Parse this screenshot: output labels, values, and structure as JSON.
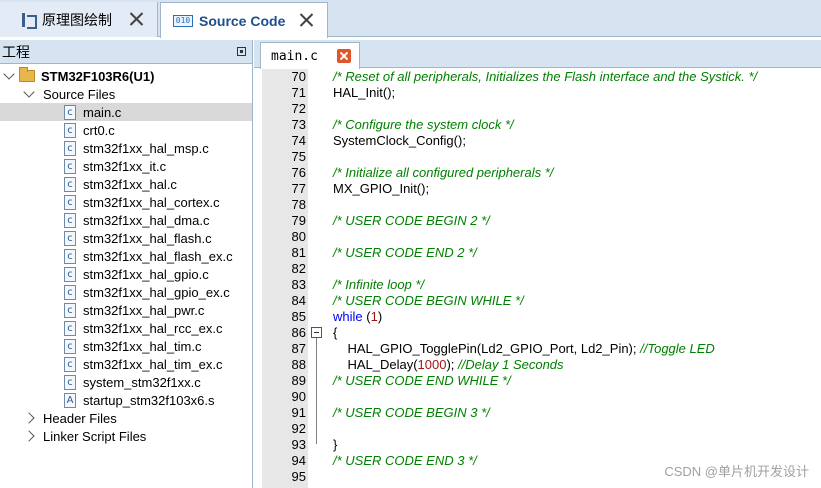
{
  "top_tabs": [
    {
      "label": "原理图绘制",
      "icon": "schematic-icon"
    },
    {
      "label": "Source Code",
      "icon": "source-code-icon",
      "icon_text": "010",
      "active": true
    }
  ],
  "project_panel": {
    "title": "工程",
    "project": "STM32F103R6(U1)",
    "source_group": "Source Files",
    "files": [
      "main.c",
      "crt0.c",
      "stm32f1xx_hal_msp.c",
      "stm32f1xx_it.c",
      "stm32f1xx_hal.c",
      "stm32f1xx_hal_cortex.c",
      "stm32f1xx_hal_dma.c",
      "stm32f1xx_hal_flash.c",
      "stm32f1xx_hal_flash_ex.c",
      "stm32f1xx_hal_gpio.c",
      "stm32f1xx_hal_gpio_ex.c",
      "stm32f1xx_hal_pwr.c",
      "stm32f1xx_hal_rcc_ex.c",
      "stm32f1xx_hal_tim.c",
      "stm32f1xx_hal_tim_ex.c",
      "system_stm32f1xx.c",
      "startup_stm32f103x6.s"
    ],
    "file_icon_letters": [
      "c",
      "c",
      "c",
      "c",
      "c",
      "c",
      "c",
      "c",
      "c",
      "c",
      "c",
      "c",
      "c",
      "c",
      "c",
      "c",
      "A"
    ],
    "groups_collapsed": [
      "Header Files",
      "Linker Script Files"
    ]
  },
  "editor": {
    "tab_label": "main.c",
    "lines": [
      {
        "n": "70",
        "t": "/* Reset of all peripherals, Initializes the Flash interface and the Systick. */",
        "k": "cm"
      },
      {
        "n": "71",
        "t": "HAL_Init();",
        "k": ""
      },
      {
        "n": "72",
        "t": "",
        "k": ""
      },
      {
        "n": "73",
        "t": "/* Configure the system clock */",
        "k": "cm"
      },
      {
        "n": "74",
        "t": "SystemClock_Config();",
        "k": ""
      },
      {
        "n": "75",
        "t": "",
        "k": ""
      },
      {
        "n": "76",
        "t": "/* Initialize all configured peripherals */",
        "k": "cm"
      },
      {
        "n": "77",
        "t": "MX_GPIO_Init();",
        "k": ""
      },
      {
        "n": "78",
        "t": "",
        "k": ""
      },
      {
        "n": "79",
        "t": "/* USER CODE BEGIN 2 */",
        "k": "cm"
      },
      {
        "n": "80",
        "t": "",
        "k": ""
      },
      {
        "n": "81",
        "t": "/* USER CODE END 2 */",
        "k": "cm"
      },
      {
        "n": "82",
        "t": "",
        "k": ""
      },
      {
        "n": "83",
        "t": "/* Infinite loop */",
        "k": "cm"
      },
      {
        "n": "84",
        "t": "/* USER CODE BEGIN WHILE */",
        "k": "cm"
      },
      {
        "n": "85",
        "t": "",
        "k": "while",
        "kw": "while",
        "open": " (",
        "num": "1",
        "close": ")"
      },
      {
        "n": "86",
        "t": "{",
        "k": ""
      },
      {
        "n": "87",
        "t": "",
        "k": "toggle",
        "code": "    HAL_GPIO_TogglePin(Ld2_GPIO_Port, Ld2_Pin); ",
        "comment": "//Toggle LED"
      },
      {
        "n": "88",
        "t": "",
        "k": "delay",
        "code": "    HAL_Delay(",
        "num": "1000",
        "code2": "); ",
        "comment": "//Delay 1 Seconds"
      },
      {
        "n": "89",
        "t": "/* USER CODE END WHILE */",
        "k": "cm"
      },
      {
        "n": "90",
        "t": "",
        "k": ""
      },
      {
        "n": "91",
        "t": "/* USER CODE BEGIN 3 */",
        "k": "cm"
      },
      {
        "n": "92",
        "t": "",
        "k": ""
      },
      {
        "n": "93",
        "t": "}",
        "k": ""
      },
      {
        "n": "94",
        "t": "/* USER CODE END 3 */",
        "k": "cm"
      },
      {
        "n": "95",
        "t": "",
        "k": ""
      }
    ]
  },
  "watermark": "CSDN @单片机开发设计",
  "colors": {
    "comment": "#008000",
    "keyword": "#0000ff",
    "number": "#a31515",
    "tab_active_text": "#1e4e8c"
  }
}
